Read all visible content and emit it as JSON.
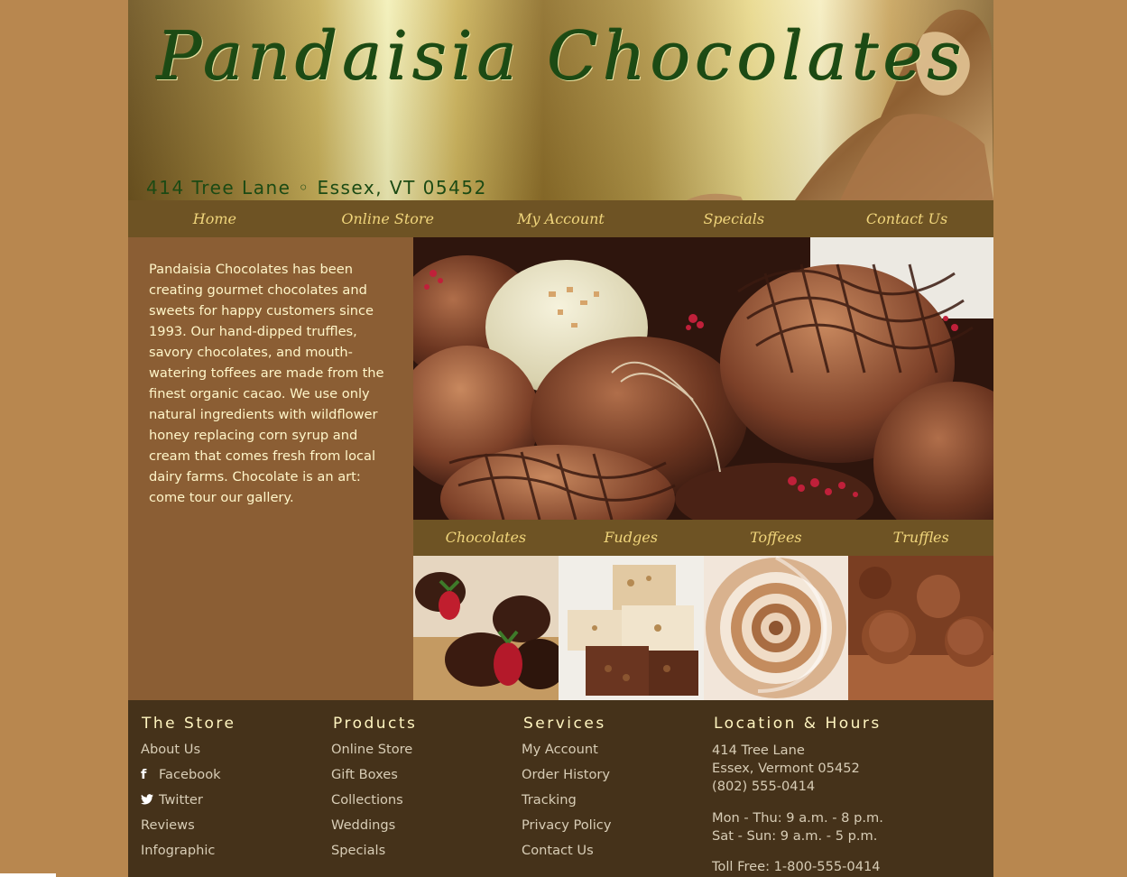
{
  "header": {
    "title": "Pandaisia Chocolates",
    "address": "414 Tree Lane ◦ Essex, VT 05452"
  },
  "nav": [
    "Home",
    "Online Store",
    "My Account",
    "Specials",
    "Contact Us"
  ],
  "intro": "Pandaisia Chocolates has been creating gourmet chocolates and sweets for happy customers since 1993. Our hand-dipped truffles, savory chocolates, and mouth-watering toffees are made from the finest organic cacao. We use only natural ingredients with wildflower honey replacing corn syrup and cream that comes fresh from local dairy farms. Chocolate is an art: come tour our gallery.",
  "categories": [
    "Chocolates",
    "Fudges",
    "Toffees",
    "Truffles"
  ],
  "footer": {
    "store": {
      "heading": "The Store",
      "links": [
        "About Us",
        "Facebook",
        "Twitter",
        "Reviews",
        "Infographic"
      ]
    },
    "products": {
      "heading": "Products",
      "links": [
        "Online Store",
        "Gift Boxes",
        "Collections",
        "Weddings",
        "Specials"
      ]
    },
    "services": {
      "heading": "Services",
      "links": [
        "My Account",
        "Order History",
        "Tracking",
        "Privacy Policy",
        "Contact Us"
      ]
    },
    "location": {
      "heading": "Location & Hours",
      "street": "414 Tree Lane",
      "city": "Essex, Vermont 05452",
      "phone": "(802) 555-0414",
      "hours_weekday": "Mon - Thu: 9 a.m. - 8 p.m.",
      "hours_weekend": "Sat - Sun: 9 a.m. - 5 p.m.",
      "toll_free": "Toll Free: 1-800-555-0414"
    }
  },
  "icons": {
    "facebook": "facebook-icon",
    "twitter": "twitter-icon"
  },
  "colors": {
    "page_background": "#b8874f",
    "content_background": "#8b5e34",
    "nav_background": "#6e5324",
    "nav_text": "#f0d57b",
    "footer_background": "#45321a",
    "title_green": "#1c4a14"
  }
}
